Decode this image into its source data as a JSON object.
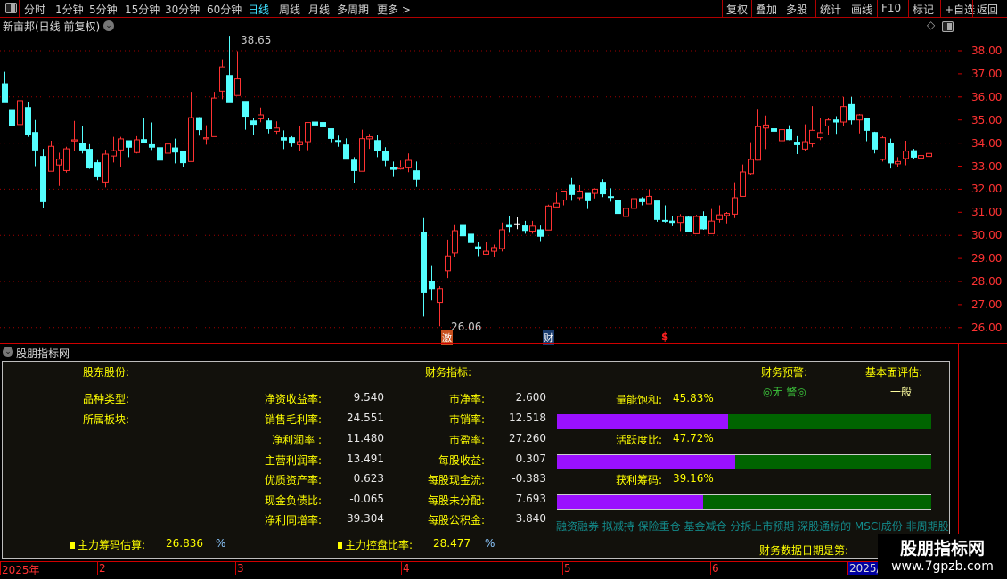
{
  "toolbar": {
    "periods": [
      "分时",
      "1分钟",
      "5分钟",
      "15分钟",
      "30分钟",
      "60分钟",
      "日线",
      "周线",
      "月线",
      "多周期",
      "更多 >"
    ],
    "active": "日线",
    "actions": [
      "复权",
      "叠加",
      "多股",
      "统计",
      "画线",
      "F10",
      "标记",
      "+自选",
      "返回"
    ]
  },
  "chart": {
    "title": "新亩邦(日线 前复权)",
    "max_label": "38.65",
    "min_label": "26.06",
    "markers": [
      "激",
      "财",
      "$"
    ],
    "up_color": "#ff3232",
    "down_color": "#54ffff",
    "y_ticks": [
      "38.00",
      "37.00",
      "36.00",
      "35.00",
      "34.00",
      "33.00",
      "32.00",
      "31.00",
      "30.00",
      "29.00",
      "28.00",
      "27.00",
      "26.00"
    ]
  },
  "chart_data": {
    "type": "candlestick",
    "ylim": [
      25.6,
      38.8
    ],
    "grid": "dotted every 2.00",
    "ohlc": [
      [
        36.57,
        37.09,
        35.75,
        35.75
      ],
      [
        35.45,
        36.12,
        34.0,
        34.77
      ],
      [
        34.8,
        35.97,
        34.16,
        35.84
      ],
      [
        35.54,
        35.77,
        34.27,
        34.36
      ],
      [
        34.46,
        35.0,
        33.0,
        33.7
      ],
      [
        33.42,
        33.75,
        31.18,
        31.46
      ],
      [
        32.78,
        34.1,
        32.78,
        33.86
      ],
      [
        33.05,
        33.58,
        32.14,
        33.3
      ],
      [
        32.81,
        33.84,
        32.72,
        33.75
      ],
      [
        34.09,
        34.96,
        33.66,
        34.14
      ],
      [
        34.0,
        34.73,
        33.55,
        33.7
      ],
      [
        33.73,
        33.95,
        32.88,
        32.92
      ],
      [
        33.15,
        33.26,
        32.39,
        32.54
      ],
      [
        32.31,
        33.71,
        32.08,
        33.52
      ],
      [
        33.44,
        34.27,
        33.16,
        33.67
      ],
      [
        33.7,
        34.27,
        32.97,
        34.18
      ],
      [
        34.1,
        34.1,
        33.39,
        33.82
      ],
      [
        33.59,
        34.3,
        33.55,
        34.14
      ],
      [
        34.15,
        35.07,
        34.04,
        34.04
      ],
      [
        33.93,
        34.89,
        33.7,
        33.82
      ],
      [
        33.8,
        33.92,
        33.07,
        33.26
      ],
      [
        33.56,
        34.49,
        33.24,
        33.96
      ],
      [
        33.79,
        34.19,
        33.12,
        33.61
      ],
      [
        33.65,
        33.65,
        32.97,
        33.15
      ],
      [
        33.2,
        36.22,
        33.2,
        35.1
      ],
      [
        35.1,
        35.13,
        34.32,
        34.58
      ],
      [
        34.18,
        34.77,
        33.93,
        34.23
      ],
      [
        34.28,
        36.22,
        34.28,
        35.95
      ],
      [
        36.25,
        37.63,
        35.9,
        37.3
      ],
      [
        36.93,
        38.65,
        35.75,
        35.75
      ],
      [
        36.06,
        37.98,
        36.06,
        36.78
      ],
      [
        35.81,
        35.81,
        34.58,
        35.16
      ],
      [
        34.96,
        35.07,
        34.36,
        34.81
      ],
      [
        35.05,
        35.54,
        34.9,
        35.22
      ],
      [
        34.96,
        35.07,
        34.42,
        34.62
      ],
      [
        34.51,
        34.94,
        34.4,
        34.65
      ],
      [
        34.23,
        34.55,
        33.74,
        34.13
      ],
      [
        34.23,
        34.3,
        33.84,
        34.0
      ],
      [
        33.93,
        34.74,
        33.65,
        34.06
      ],
      [
        34.06,
        34.89,
        33.69,
        34.89
      ],
      [
        34.91,
        34.96,
        34.58,
        34.78
      ],
      [
        34.89,
        35.54,
        34.64,
        34.7
      ],
      [
        34.62,
        34.62,
        34.04,
        34.2
      ],
      [
        34.11,
        34.32,
        33.84,
        34.1
      ],
      [
        33.92,
        34.2,
        33.3,
        33.3
      ],
      [
        33.26,
        33.39,
        32.26,
        32.81
      ],
      [
        32.78,
        34.58,
        32.78,
        34.19
      ],
      [
        34.18,
        34.4,
        33.75,
        34.27
      ],
      [
        34.11,
        34.36,
        33.39,
        33.66
      ],
      [
        33.65,
        33.82,
        33.0,
        33.24
      ],
      [
        32.95,
        33.2,
        32.53,
        32.86
      ],
      [
        32.88,
        33.24,
        32.85,
        32.95
      ],
      [
        32.93,
        33.55,
        32.74,
        33.25
      ],
      [
        32.8,
        33.2,
        32.1,
        32.43
      ],
      [
        30.14,
        30.75,
        26.48,
        27.52
      ],
      [
        28.0,
        28.67,
        27.18,
        27.7
      ],
      [
        27.09,
        27.8,
        26.06,
        27.7
      ],
      [
        28.47,
        29.82,
        28.15,
        29.11
      ],
      [
        29.24,
        30.44,
        29.08,
        30.2
      ],
      [
        30.43,
        30.56,
        29.98,
        29.98
      ],
      [
        30.05,
        30.43,
        29.57,
        29.69
      ],
      [
        29.5,
        29.7,
        29.1,
        29.43
      ],
      [
        29.18,
        29.7,
        29.18,
        29.31
      ],
      [
        29.31,
        29.6,
        29.08,
        29.47
      ],
      [
        29.43,
        30.56,
        29.3,
        30.24
      ],
      [
        30.43,
        30.85,
        30.11,
        30.37
      ],
      [
        30.5,
        30.78,
        30.27,
        30.5
      ],
      [
        30.41,
        30.63,
        30.07,
        30.21
      ],
      [
        30.18,
        30.63,
        30.07,
        30.4
      ],
      [
        30.24,
        30.43,
        29.72,
        29.96
      ],
      [
        30.23,
        31.33,
        30.23,
        31.27
      ],
      [
        31.23,
        31.85,
        31.23,
        31.39
      ],
      [
        31.53,
        31.92,
        31.3,
        31.92
      ],
      [
        32.17,
        32.49,
        31.5,
        31.77
      ],
      [
        31.63,
        32.17,
        31.5,
        31.92
      ],
      [
        31.82,
        31.82,
        31.14,
        31.5
      ],
      [
        31.82,
        32.04,
        31.6,
        32.0
      ],
      [
        32.3,
        32.43,
        31.66,
        31.8
      ],
      [
        31.68,
        32.04,
        31.46,
        31.66
      ],
      [
        31.53,
        31.76,
        30.92,
        30.95
      ],
      [
        30.82,
        31.46,
        30.82,
        31.17
      ],
      [
        31.17,
        31.72,
        30.75,
        31.59
      ],
      [
        31.59,
        31.66,
        31.3,
        31.46
      ],
      [
        31.36,
        32.0,
        31.36,
        31.69
      ],
      [
        31.49,
        31.49,
        30.59,
        30.69
      ],
      [
        30.65,
        31.3,
        30.56,
        30.62
      ],
      [
        30.62,
        30.82,
        30.4,
        30.56
      ],
      [
        30.56,
        30.92,
        30.18,
        30.82
      ],
      [
        30.79,
        30.85,
        30.15,
        30.17
      ],
      [
        30.07,
        30.89,
        30.07,
        30.82
      ],
      [
        30.82,
        31.04,
        30.24,
        30.28
      ],
      [
        30.07,
        31.14,
        30.07,
        30.62
      ],
      [
        30.69,
        31.3,
        30.56,
        30.89
      ],
      [
        30.86,
        31.01,
        30.52,
        30.95
      ],
      [
        30.92,
        32.3,
        30.75,
        31.63
      ],
      [
        31.69,
        33.07,
        31.69,
        32.75
      ],
      [
        32.68,
        34.04,
        32.62,
        33.29
      ],
      [
        33.26,
        35.48,
        33.24,
        34.71
      ],
      [
        34.65,
        35.19,
        33.74,
        34.78
      ],
      [
        34.62,
        35.0,
        34.23,
        34.51
      ],
      [
        34.1,
        34.68,
        33.97,
        34.58
      ],
      [
        34.58,
        34.77,
        34.12,
        34.15
      ],
      [
        34.04,
        34.3,
        33.52,
        33.93
      ],
      [
        33.74,
        34.81,
        33.67,
        34.06
      ],
      [
        33.97,
        35.6,
        33.82,
        34.55
      ],
      [
        34.23,
        35.07,
        34.13,
        34.45
      ],
      [
        34.74,
        35.07,
        34.36,
        35.0
      ],
      [
        35.0,
        35.16,
        34.4,
        34.91
      ],
      [
        34.91,
        36.0,
        34.74,
        35.58
      ],
      [
        35.67,
        36.0,
        34.81,
        35.0
      ],
      [
        35.0,
        35.26,
        34.42,
        35.22
      ],
      [
        35.07,
        35.07,
        34.08,
        34.55
      ],
      [
        34.46,
        34.49,
        33.55,
        33.74
      ],
      [
        33.29,
        34.3,
        33.2,
        34.23
      ],
      [
        34.0,
        34.19,
        32.9,
        33.14
      ],
      [
        33.1,
        33.39,
        32.94,
        33.2
      ],
      [
        33.33,
        34.1,
        33.04,
        33.65
      ],
      [
        33.67,
        33.75,
        33.3,
        33.39
      ],
      [
        33.35,
        33.65,
        33.16,
        33.46
      ],
      [
        33.42,
        33.97,
        33.05,
        33.55
      ]
    ]
  },
  "indicator": {
    "title": "股朋指标网",
    "sec_holder": "股东股份:",
    "sec_fin": "财务指标:",
    "sec_warn": "财务预警:",
    "sec_eval": "基本面评估:",
    "warn_value": "◎无 警◎",
    "eval_value": "一般",
    "type_label": "品种类型:",
    "board_label": "所属板块:",
    "col1": [
      {
        "label": "净资收益率:",
        "value": "9.540"
      },
      {
        "label": "销售毛利率:",
        "value": "24.551"
      },
      {
        "label": "净利润率 :",
        "value": "11.480"
      },
      {
        "label": "主营利润率:",
        "value": "13.491"
      },
      {
        "label": "优质资产率:",
        "value": "0.623"
      },
      {
        "label": "现金负债比:",
        "value": "-0.065"
      },
      {
        "label": "净利同增率:",
        "value": "39.304"
      }
    ],
    "col2": [
      {
        "label": "市净率:",
        "value": "2.600"
      },
      {
        "label": "市销率:",
        "value": "12.518"
      },
      {
        "label": "市盈率:",
        "value": "27.260"
      },
      {
        "label": "每股收益:",
        "value": "0.307"
      },
      {
        "label": "每股现金流:",
        "value": "-0.383"
      },
      {
        "label": "每股未分配:",
        "value": "7.693"
      },
      {
        "label": "每股公积金:",
        "value": "3.840"
      }
    ],
    "bars": [
      {
        "label": "量能饱和:",
        "text": "45.83%",
        "value": 45.83
      },
      {
        "label": "活跃度比:",
        "text": "47.72%",
        "value": 47.72
      },
      {
        "label": "获利筹码:",
        "text": "39.16%",
        "value": 39.16
      }
    ],
    "bar_colors": {
      "fill": "#9a10ff",
      "rest": "#006400"
    },
    "tags": "融资融券 拟减持 保险重仓 基金减仓 分拆上市预期 深股通标的 MSCI成份 非周期股",
    "chip_label": "主力筹码估算:",
    "chip_value": "26.836",
    "chip_unit": "%",
    "control_label": "主力控盘比率:",
    "control_value": "28.477",
    "control_unit": "%",
    "date_label": "财务数据日期是第:"
  },
  "timeaxis": {
    "labels": [
      "2025年",
      "2",
      "3",
      "4",
      "5",
      "6",
      "2025/"
    ]
  },
  "watermark": {
    "name": "股朋指标网",
    "url": "www.7gpzb.com"
  }
}
